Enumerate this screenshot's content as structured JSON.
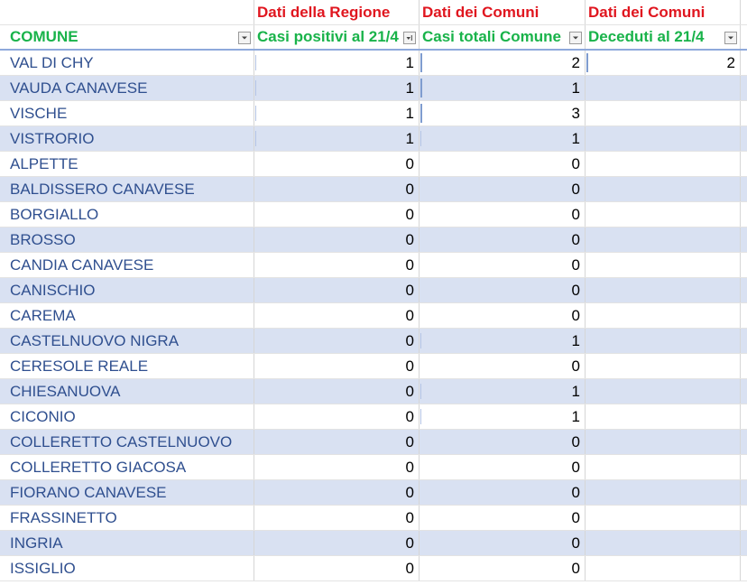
{
  "super_headers": {
    "col1": "Dati della Regione",
    "col2": "Dati dei Comuni",
    "col3": "Dati dei Comuni"
  },
  "headers": {
    "col0": "COMUNE",
    "col1": "Casi positivi al 21/4",
    "col2": "Casi totali Comune",
    "col3": "Deceduti al 21/4"
  },
  "rows": [
    {
      "comune": "VAL DI CHY",
      "positivi": "1",
      "totali": "2",
      "deceduti": "2"
    },
    {
      "comune": "VAUDA CANAVESE",
      "positivi": "1",
      "totali": "1",
      "deceduti": ""
    },
    {
      "comune": "VISCHE",
      "positivi": "1",
      "totali": "3",
      "deceduti": ""
    },
    {
      "comune": "VISTRORIO",
      "positivi": "1",
      "totali": "1",
      "deceduti": ""
    },
    {
      "comune": "ALPETTE",
      "positivi": "0",
      "totali": "0",
      "deceduti": ""
    },
    {
      "comune": "BALDISSERO CANAVESE",
      "positivi": "0",
      "totali": "0",
      "deceduti": ""
    },
    {
      "comune": "BORGIALLO",
      "positivi": "0",
      "totali": "0",
      "deceduti": ""
    },
    {
      "comune": "BROSSO",
      "positivi": "0",
      "totali": "0",
      "deceduti": ""
    },
    {
      "comune": "CANDIA CANAVESE",
      "positivi": "0",
      "totali": "0",
      "deceduti": ""
    },
    {
      "comune": "CANISCHIO",
      "positivi": "0",
      "totali": "0",
      "deceduti": ""
    },
    {
      "comune": "CAREMA",
      "positivi": "0",
      "totali": "0",
      "deceduti": ""
    },
    {
      "comune": "CASTELNUOVO NIGRA",
      "positivi": "0",
      "totali": "1",
      "deceduti": ""
    },
    {
      "comune": "CERESOLE REALE",
      "positivi": "0",
      "totali": "0",
      "deceduti": ""
    },
    {
      "comune": "CHIESANUOVA",
      "positivi": "0",
      "totali": "1",
      "deceduti": ""
    },
    {
      "comune": "CICONIO",
      "positivi": "0",
      "totali": "1",
      "deceduti": ""
    },
    {
      "comune": "COLLERETTO CASTELNUOVO",
      "positivi": "0",
      "totali": "0",
      "deceduti": ""
    },
    {
      "comune": "COLLERETTO GIACOSA",
      "positivi": "0",
      "totali": "0",
      "deceduti": ""
    },
    {
      "comune": "FIORANO CANAVESE",
      "positivi": "0",
      "totali": "0",
      "deceduti": ""
    },
    {
      "comune": "FRASSINETTO",
      "positivi": "0",
      "totali": "0",
      "deceduti": ""
    },
    {
      "comune": "INGRIA",
      "positivi": "0",
      "totali": "0",
      "deceduti": ""
    },
    {
      "comune": "ISSIGLIO",
      "positivi": "0",
      "totali": "0",
      "deceduti": ""
    }
  ],
  "icons": {
    "filter": "chevron-down-icon",
    "sorted_filter": "sort-descending-icon"
  },
  "colors": {
    "super_header": "#e0161f",
    "header": "#19b34a",
    "name_text": "#2f4f8f",
    "band": "#d9e1f2"
  }
}
